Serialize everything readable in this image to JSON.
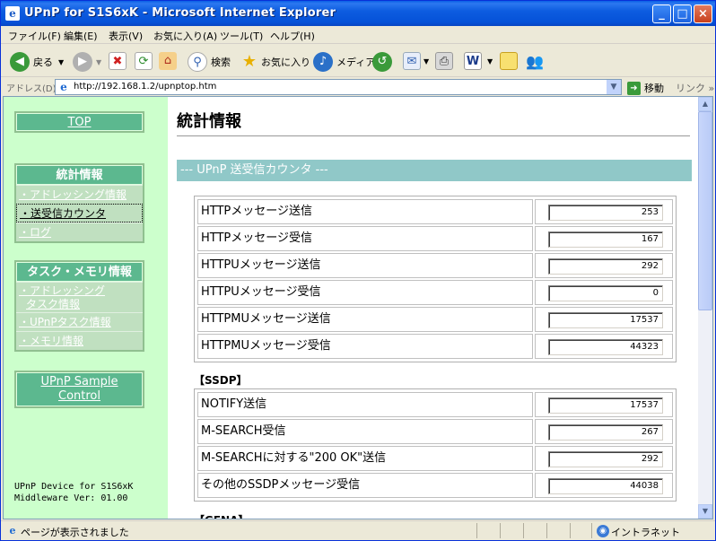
{
  "window": {
    "title": "UPnP for S1S6xK - Microsoft Internet Explorer",
    "controls": {
      "minimize": "_",
      "maximize": "□",
      "close": "×"
    }
  },
  "menu": [
    "ファイル(F)",
    "編集(E)",
    "表示(V)",
    "お気に入り(A)",
    "ツール(T)",
    "ヘルプ(H)"
  ],
  "toolbar": {
    "back": "戻る",
    "search": "検索",
    "favorites": "お気に入り",
    "media": "メディア"
  },
  "address": {
    "label": "アドレス(D)",
    "url": "http://192.168.1.2/upnptop.htm",
    "go": "移動",
    "links": "リンク »"
  },
  "nav": {
    "top": "TOP",
    "stats": {
      "heading": "統計情報",
      "items": [
        "・アドレッシング情報",
        "・送受信カウンタ",
        "・ログ"
      ]
    },
    "task": {
      "heading": "タスク・メモリ情報",
      "item1_line1": "・アドレッシング",
      "item1_line2": "タスク情報",
      "items": [
        "・UPnPタスク情報",
        "・メモリ情報"
      ]
    },
    "sample_line1": "UPnP Sample",
    "sample_line2": "Control",
    "footer_line1": "UPnP Device for S1S6xK",
    "footer_line2": "Middleware Ver: 01.00"
  },
  "main": {
    "title": "統計情報",
    "section": "--- UPnP 送受信カウンタ ---",
    "http_rows": [
      {
        "label": "HTTPメッセージ送信",
        "value": "253"
      },
      {
        "label": "HTTPメッセージ受信",
        "value": "167"
      },
      {
        "label": "HTTPUメッセージ送信",
        "value": "292"
      },
      {
        "label": "HTTPUメッセージ受信",
        "value": "0"
      },
      {
        "label": "HTTPMUメッセージ送信",
        "value": "17537"
      },
      {
        "label": "HTTPMUメッセージ受信",
        "value": "44323"
      }
    ],
    "ssdp_label": "【SSDP】",
    "ssdp_rows": [
      {
        "label": "NOTIFY送信",
        "value": "17537"
      },
      {
        "label": "M-SEARCH受信",
        "value": "267"
      },
      {
        "label": "M-SEARCHに対する\"200 OK\"送信",
        "value": "292"
      },
      {
        "label": "その他のSSDPメッセージ受信",
        "value": "44038"
      }
    ],
    "gena_label": "【GENA】"
  },
  "status": {
    "text": "ページが表示されました",
    "zone": "イントラネット"
  },
  "colors": {
    "nav_bg": "#ccffcc",
    "nav_heading": "#5cb88f",
    "section_bar": "#90c8c8",
    "titlebar": "#0552d8"
  }
}
